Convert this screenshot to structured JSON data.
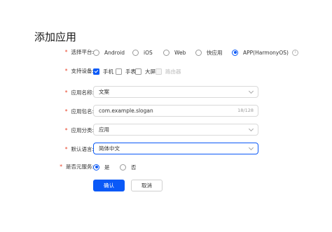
{
  "page": {
    "title": "添加应用"
  },
  "form": {
    "platform": {
      "label": "选择平台:",
      "options": [
        "Android",
        "iOS",
        "Web",
        "快应用",
        "APP(HarmonyOS)"
      ],
      "selected": "APP(HarmonyOS)"
    },
    "devices": {
      "label": "支持设备:",
      "options": [
        {
          "label": "手机",
          "checked": true
        },
        {
          "label": "手表",
          "checked": false
        },
        {
          "label": "大屏",
          "checked": false
        },
        {
          "label": "路由器",
          "checked": false,
          "disabled": true
        }
      ]
    },
    "app_name": {
      "label": "应用名称:",
      "value": "文案"
    },
    "package_name": {
      "label": "应用包名:",
      "value": "com.example.slogan",
      "counter": "18/128"
    },
    "category": {
      "label": "应用分类:",
      "value": "应用"
    },
    "language": {
      "label": "默认语言:",
      "value": "简体中文"
    },
    "meta_service": {
      "label": "是否元服务:",
      "options": [
        "是",
        "否"
      ],
      "selected": "是"
    }
  },
  "actions": {
    "confirm": "确认",
    "cancel": "取消"
  },
  "colors": {
    "accent": "#0a59f7",
    "required": "#e84026",
    "border": "#d9d9d9"
  }
}
